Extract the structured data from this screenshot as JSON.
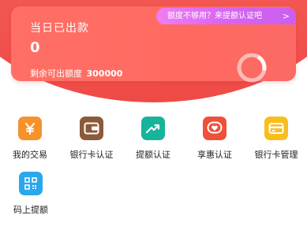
{
  "header": {
    "title": "当日已出款",
    "amount": "0",
    "quota_label": "剩余可出额度",
    "quota_value": "300000",
    "promo_text": "额度不够用？来提额认证吧",
    "promo_arrow": ">"
  },
  "menu": [
    {
      "label": "我的交易",
      "icon": "yen-icon",
      "color": "#f5922b"
    },
    {
      "label": "银行卡认证",
      "icon": "wallet-icon",
      "color": "#8b5a3a"
    },
    {
      "label": "提额认证",
      "icon": "trend-up-icon",
      "color": "#17b39a"
    },
    {
      "label": "享惠认证",
      "icon": "heart-badge-icon",
      "color": "#f0503a"
    },
    {
      "label": "银行卡管理",
      "icon": "card-icon",
      "color": "#f7be1c"
    },
    {
      "label": "码上提额",
      "icon": "qr-code-icon",
      "color": "#2aa7ee"
    }
  ]
}
